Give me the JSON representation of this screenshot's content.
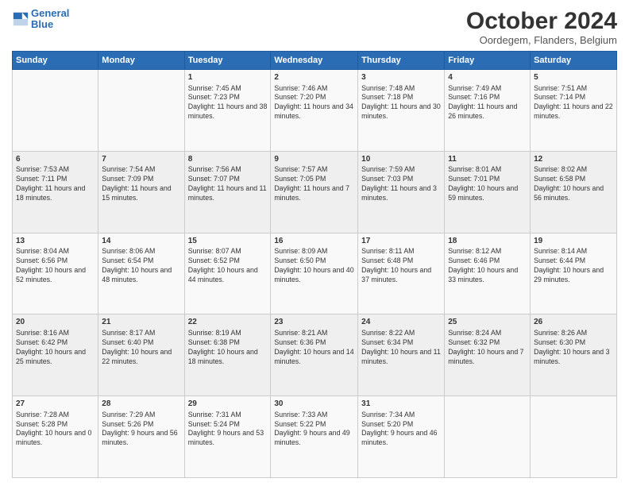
{
  "logo": {
    "line1": "General",
    "line2": "Blue"
  },
  "title": "October 2024",
  "subtitle": "Oordegem, Flanders, Belgium",
  "weekdays": [
    "Sunday",
    "Monday",
    "Tuesday",
    "Wednesday",
    "Thursday",
    "Friday",
    "Saturday"
  ],
  "rows": [
    [
      {
        "day": "",
        "info": ""
      },
      {
        "day": "",
        "info": ""
      },
      {
        "day": "1",
        "info": "Sunrise: 7:45 AM\nSunset: 7:23 PM\nDaylight: 11 hours and 38 minutes."
      },
      {
        "day": "2",
        "info": "Sunrise: 7:46 AM\nSunset: 7:20 PM\nDaylight: 11 hours and 34 minutes."
      },
      {
        "day": "3",
        "info": "Sunrise: 7:48 AM\nSunset: 7:18 PM\nDaylight: 11 hours and 30 minutes."
      },
      {
        "day": "4",
        "info": "Sunrise: 7:49 AM\nSunset: 7:16 PM\nDaylight: 11 hours and 26 minutes."
      },
      {
        "day": "5",
        "info": "Sunrise: 7:51 AM\nSunset: 7:14 PM\nDaylight: 11 hours and 22 minutes."
      }
    ],
    [
      {
        "day": "6",
        "info": "Sunrise: 7:53 AM\nSunset: 7:11 PM\nDaylight: 11 hours and 18 minutes."
      },
      {
        "day": "7",
        "info": "Sunrise: 7:54 AM\nSunset: 7:09 PM\nDaylight: 11 hours and 15 minutes."
      },
      {
        "day": "8",
        "info": "Sunrise: 7:56 AM\nSunset: 7:07 PM\nDaylight: 11 hours and 11 minutes."
      },
      {
        "day": "9",
        "info": "Sunrise: 7:57 AM\nSunset: 7:05 PM\nDaylight: 11 hours and 7 minutes."
      },
      {
        "day": "10",
        "info": "Sunrise: 7:59 AM\nSunset: 7:03 PM\nDaylight: 11 hours and 3 minutes."
      },
      {
        "day": "11",
        "info": "Sunrise: 8:01 AM\nSunset: 7:01 PM\nDaylight: 10 hours and 59 minutes."
      },
      {
        "day": "12",
        "info": "Sunrise: 8:02 AM\nSunset: 6:58 PM\nDaylight: 10 hours and 56 minutes."
      }
    ],
    [
      {
        "day": "13",
        "info": "Sunrise: 8:04 AM\nSunset: 6:56 PM\nDaylight: 10 hours and 52 minutes."
      },
      {
        "day": "14",
        "info": "Sunrise: 8:06 AM\nSunset: 6:54 PM\nDaylight: 10 hours and 48 minutes."
      },
      {
        "day": "15",
        "info": "Sunrise: 8:07 AM\nSunset: 6:52 PM\nDaylight: 10 hours and 44 minutes."
      },
      {
        "day": "16",
        "info": "Sunrise: 8:09 AM\nSunset: 6:50 PM\nDaylight: 10 hours and 40 minutes."
      },
      {
        "day": "17",
        "info": "Sunrise: 8:11 AM\nSunset: 6:48 PM\nDaylight: 10 hours and 37 minutes."
      },
      {
        "day": "18",
        "info": "Sunrise: 8:12 AM\nSunset: 6:46 PM\nDaylight: 10 hours and 33 minutes."
      },
      {
        "day": "19",
        "info": "Sunrise: 8:14 AM\nSunset: 6:44 PM\nDaylight: 10 hours and 29 minutes."
      }
    ],
    [
      {
        "day": "20",
        "info": "Sunrise: 8:16 AM\nSunset: 6:42 PM\nDaylight: 10 hours and 25 minutes."
      },
      {
        "day": "21",
        "info": "Sunrise: 8:17 AM\nSunset: 6:40 PM\nDaylight: 10 hours and 22 minutes."
      },
      {
        "day": "22",
        "info": "Sunrise: 8:19 AM\nSunset: 6:38 PM\nDaylight: 10 hours and 18 minutes."
      },
      {
        "day": "23",
        "info": "Sunrise: 8:21 AM\nSunset: 6:36 PM\nDaylight: 10 hours and 14 minutes."
      },
      {
        "day": "24",
        "info": "Sunrise: 8:22 AM\nSunset: 6:34 PM\nDaylight: 10 hours and 11 minutes."
      },
      {
        "day": "25",
        "info": "Sunrise: 8:24 AM\nSunset: 6:32 PM\nDaylight: 10 hours and 7 minutes."
      },
      {
        "day": "26",
        "info": "Sunrise: 8:26 AM\nSunset: 6:30 PM\nDaylight: 10 hours and 3 minutes."
      }
    ],
    [
      {
        "day": "27",
        "info": "Sunrise: 7:28 AM\nSunset: 5:28 PM\nDaylight: 10 hours and 0 minutes."
      },
      {
        "day": "28",
        "info": "Sunrise: 7:29 AM\nSunset: 5:26 PM\nDaylight: 9 hours and 56 minutes."
      },
      {
        "day": "29",
        "info": "Sunrise: 7:31 AM\nSunset: 5:24 PM\nDaylight: 9 hours and 53 minutes."
      },
      {
        "day": "30",
        "info": "Sunrise: 7:33 AM\nSunset: 5:22 PM\nDaylight: 9 hours and 49 minutes."
      },
      {
        "day": "31",
        "info": "Sunrise: 7:34 AM\nSunset: 5:20 PM\nDaylight: 9 hours and 46 minutes."
      },
      {
        "day": "",
        "info": ""
      },
      {
        "day": "",
        "info": ""
      }
    ]
  ]
}
